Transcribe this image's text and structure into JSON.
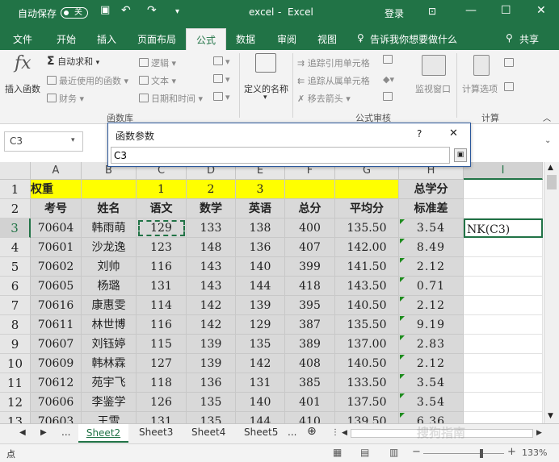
{
  "titlebar": {
    "autosave_label": "自动保存",
    "autosave_state": "关",
    "file_title": "excel",
    "app_separator": "-",
    "app_name": "Excel",
    "login_label": "登录"
  },
  "ribbon_tabs": [
    "文件",
    "开始",
    "插入",
    "页面布局",
    "公式",
    "数据",
    "审阅",
    "视图"
  ],
  "active_tab": "公式",
  "tell_me": "告诉我你想要做什么",
  "share_label": "共享",
  "ribbon": {
    "insert_function": "插入函数",
    "autosum": "自动求和",
    "recently_used": "最近使用的函数",
    "financial": "财务",
    "logical": "逻辑",
    "text": "文本",
    "datetime": "日期和时间",
    "function_library": "函数库",
    "defined_names": "定义的名称",
    "trace_precedents": "追踪引用单元格",
    "trace_dependents": "追踪从属单元格",
    "remove_arrows": "移去箭头",
    "watch_window": "监视窗口",
    "formula_auditing": "公式审核",
    "calc_options": "计算选项",
    "calculation": "计算"
  },
  "name_box": "C3",
  "dialog": {
    "title": "函数参数",
    "help": "?",
    "close": "✕",
    "input_value": "C3"
  },
  "columns": [
    "A",
    "B",
    "C",
    "D",
    "E",
    "F",
    "G",
    "H",
    "I"
  ],
  "active_column": "I",
  "row_numbers": [
    "1",
    "2",
    "3",
    "4",
    "5",
    "6",
    "7",
    "8",
    "9",
    "10",
    "11",
    "12",
    "13"
  ],
  "active_row": "3",
  "row1": {
    "a": "权重",
    "c": "1",
    "d": "2",
    "e": "3",
    "h": "总学分"
  },
  "headers": [
    "考号",
    "姓名",
    "语文",
    "数学",
    "英语",
    "总分",
    "平均分",
    "标准差"
  ],
  "rows": [
    [
      "70604",
      "韩雨萌",
      "129",
      "133",
      "138",
      "400",
      "135.50",
      "3.54"
    ],
    [
      "70601",
      "沙龙逸",
      "123",
      "148",
      "136",
      "407",
      "142.00",
      "8.49"
    ],
    [
      "70602",
      "刘帅",
      "116",
      "143",
      "140",
      "399",
      "141.50",
      "2.12"
    ],
    [
      "70605",
      "杨璐",
      "131",
      "143",
      "144",
      "418",
      "143.50",
      "0.71"
    ],
    [
      "70616",
      "康惠雯",
      "114",
      "142",
      "139",
      "395",
      "140.50",
      "2.12"
    ],
    [
      "70611",
      "林世博",
      "116",
      "142",
      "129",
      "387",
      "135.50",
      "9.19"
    ],
    [
      "70607",
      "刘钰婷",
      "115",
      "139",
      "135",
      "389",
      "137.00",
      "2.83"
    ],
    [
      "70609",
      "韩林霖",
      "127",
      "139",
      "142",
      "408",
      "140.50",
      "2.12"
    ],
    [
      "70612",
      "苑宇飞",
      "118",
      "136",
      "131",
      "385",
      "133.50",
      "3.54"
    ],
    [
      "70606",
      "李鉴学",
      "126",
      "135",
      "140",
      "401",
      "137.50",
      "3.54"
    ],
    [
      "70603",
      "王雪",
      "131",
      "135",
      "144",
      "410",
      "139.50",
      "6.36"
    ]
  ],
  "i3_formula_fragment": "NK(C3)",
  "sheets": [
    "Sheet2",
    "Sheet3",
    "Sheet4",
    "Sheet5"
  ],
  "active_sheet": "Sheet2",
  "more_sheets": "...",
  "status": {
    "mode": "点",
    "zoom": "133%"
  },
  "watermark": "搜狗指南",
  "colors": {
    "brand_green": "#217346",
    "yellow": "#ffff00",
    "cell_gray": "#d9d9d9"
  }
}
